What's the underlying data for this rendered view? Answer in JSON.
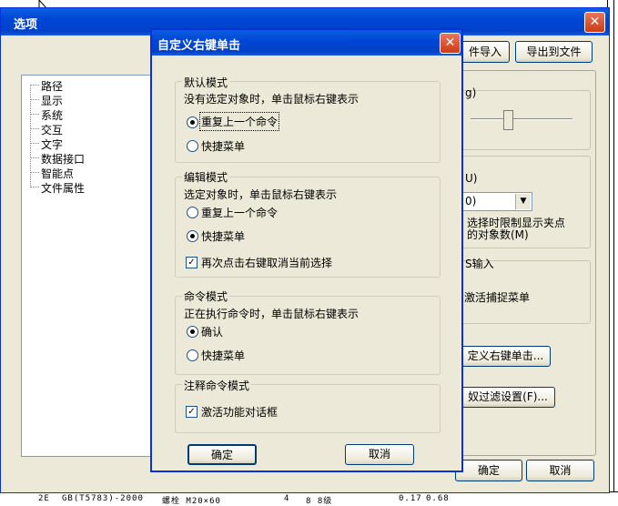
{
  "main": {
    "title": "选项",
    "top_buttons": {
      "import": "件导入",
      "export": "导出到文件"
    },
    "tree": [
      "路径",
      "显示",
      "系统",
      "交互",
      "文字",
      "数据接口",
      "智能点",
      "文件属性"
    ],
    "right_panel": {
      "frag1": "g)",
      "frag2": "U)",
      "combo_value": "0)",
      "frag3": "选择时限制显示夹点",
      "frag4": "的对象数(M)",
      "frag5": "S输入",
      "frag6": "激活捕捉菜单",
      "btn_custom": "定义右键单击...",
      "btn_filter": "奴过滤设置(F)..."
    },
    "ok": "确定",
    "cancel": "取消"
  },
  "dialog": {
    "title": "自定义右键单击",
    "default_mode": {
      "legend": "默认模式",
      "desc": "没有选定对象时，单击鼠标右键表示",
      "opt1": "重复上一个命令",
      "opt2": "快捷菜单"
    },
    "edit_mode": {
      "legend": "编辑模式",
      "desc": "选定对象时，单击鼠标右键表示",
      "opt1": "重复上一个命令",
      "opt2": "快捷菜单",
      "check": "再次点击右键取消当前选择"
    },
    "command_mode": {
      "legend": "命令模式",
      "desc": "正在执行命令时，单击鼠标右键表示",
      "opt1": "确认",
      "opt2": "快捷菜单"
    },
    "comment_mode": {
      "legend": "注释命令模式",
      "check": "激活功能对话框"
    },
    "ok": "确定",
    "cancel": "取消"
  },
  "background_strip": [
    "2E",
    "GB(T5783)-2000",
    "螺栓 M20×60",
    "4",
    "8 8级",
    "0.17",
    "0.68"
  ]
}
